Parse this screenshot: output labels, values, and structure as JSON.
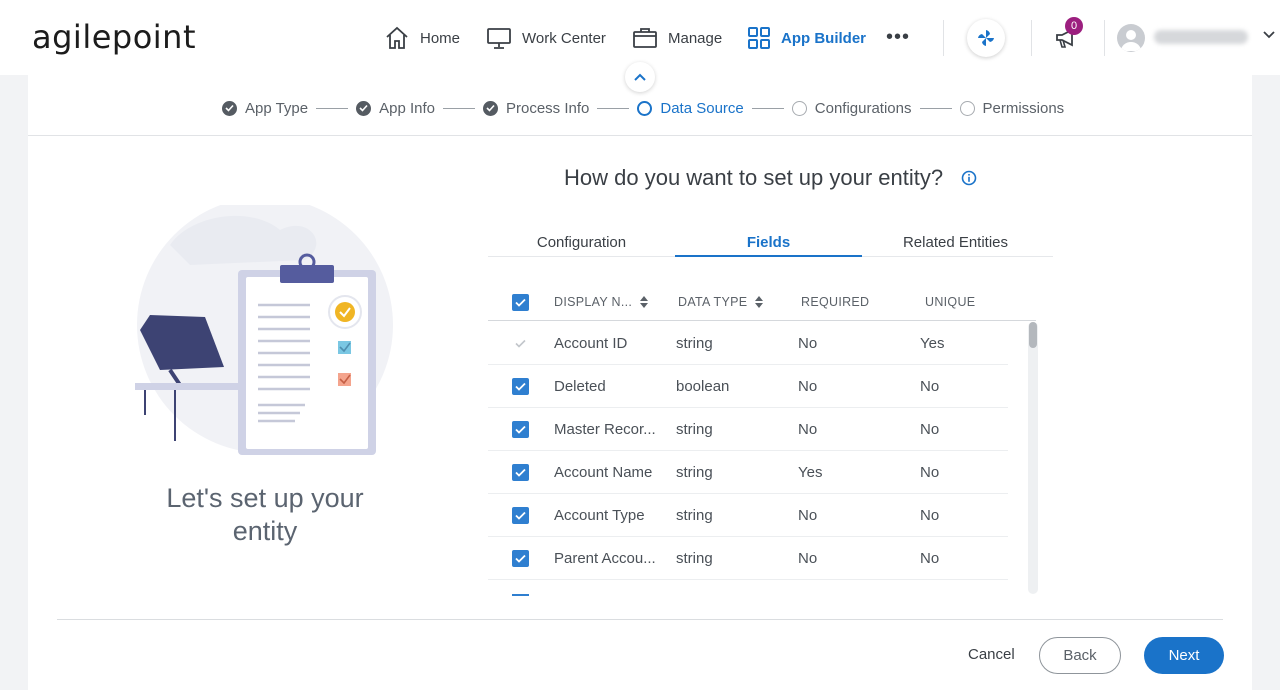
{
  "brand": {
    "logo_text": "agilepoint"
  },
  "nav": {
    "items": [
      {
        "label": "Home",
        "icon": "home-icon"
      },
      {
        "label": "Work Center",
        "icon": "monitor-icon"
      },
      {
        "label": "Manage",
        "icon": "briefcase-icon"
      },
      {
        "label": "App Builder",
        "icon": "grid-icon",
        "active": true
      }
    ],
    "more_label": "•••",
    "notification_count": "0"
  },
  "stepper": {
    "steps": [
      {
        "label": "App Type",
        "state": "done"
      },
      {
        "label": "App Info",
        "state": "done"
      },
      {
        "label": "Process Info",
        "state": "done"
      },
      {
        "label": "Data Source",
        "state": "current"
      },
      {
        "label": "Configurations",
        "state": "todo"
      },
      {
        "label": "Permissions",
        "state": "todo"
      }
    ]
  },
  "illustration": {
    "title": "Let's set up your entity"
  },
  "main": {
    "heading": "How do you want to set up your entity?",
    "tabs": [
      {
        "label": "Configuration"
      },
      {
        "label": "Fields",
        "active": true
      },
      {
        "label": "Related Entities"
      }
    ]
  },
  "table": {
    "columns": [
      "DISPLAY N...",
      "DATA TYPE",
      "REQUIRED",
      "UNIQUE"
    ],
    "rows": [
      {
        "name": "Account ID",
        "type": "string",
        "required": "No",
        "unique": "Yes",
        "checked": true,
        "disabled": true
      },
      {
        "name": "Deleted",
        "type": "boolean",
        "required": "No",
        "unique": "No",
        "checked": true
      },
      {
        "name": "Master Recor...",
        "type": "string",
        "required": "No",
        "unique": "No",
        "checked": true
      },
      {
        "name": "Account Name",
        "type": "string",
        "required": "Yes",
        "unique": "No",
        "checked": true
      },
      {
        "name": "Account Type",
        "type": "string",
        "required": "No",
        "unique": "No",
        "checked": true
      },
      {
        "name": "Parent Accou...",
        "type": "string",
        "required": "No",
        "unique": "No",
        "checked": true
      }
    ]
  },
  "footer": {
    "cancel": "Cancel",
    "back": "Back",
    "next": "Next"
  },
  "colors": {
    "accent": "#1a73c9",
    "badge": "#9c1f7f",
    "checkbox": "#2f7fd0"
  }
}
